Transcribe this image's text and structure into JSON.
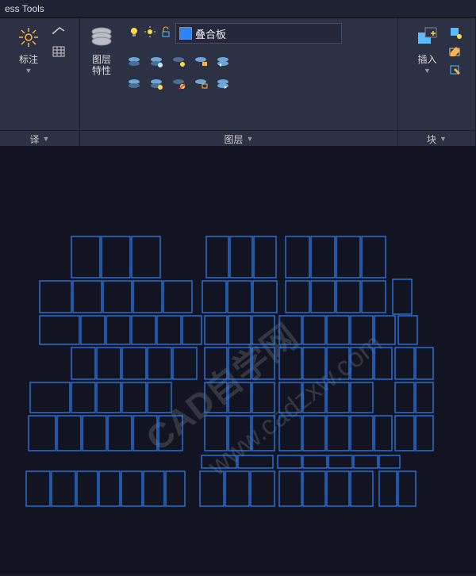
{
  "tab": {
    "title": "ess Tools"
  },
  "ribbon": {
    "panel_ann": {
      "title": "译",
      "btn1": "标注"
    },
    "panel_layer": {
      "title": "图层",
      "big": "图层\n特性",
      "layer_name": "叠合板"
    },
    "panel_block": {
      "title": "块",
      "big": "插入"
    }
  },
  "watermark": [
    "CAD自学网",
    "www.cadzxw.com"
  ],
  "icons": {
    "sun": "sun",
    "lightbulb": "lightbulb",
    "lightbulb_on": "lightbulb-on",
    "lock": "lock",
    "unlock": "unlock",
    "layer_props": "layer-properties",
    "layers1": "layer-stack",
    "layers2": "layer-stack-alt",
    "freeze": "freeze",
    "isolate": "isolate",
    "unisolate": "unisolate",
    "match": "match-layer",
    "insert": "insert-block",
    "create": "create-block",
    "edit": "edit-block",
    "edit_attr": "edit-attributes",
    "chev": "chevron-down"
  }
}
